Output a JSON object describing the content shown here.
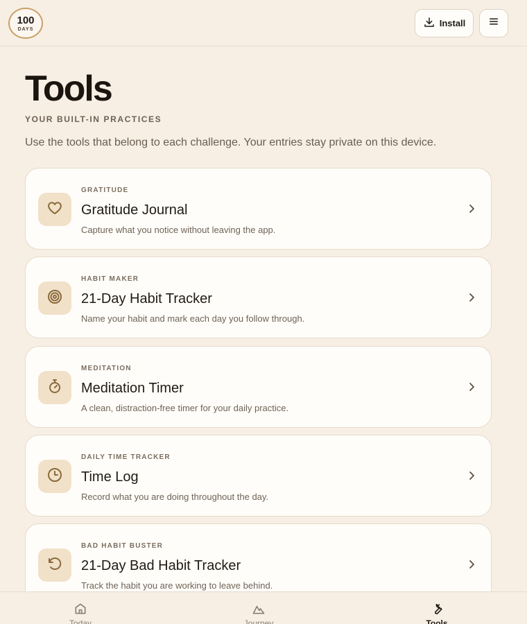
{
  "header": {
    "logo_number": "100",
    "logo_sub": "DAYS",
    "install_label": "Install"
  },
  "page": {
    "title": "Tools",
    "eyebrow": "YOUR BUILT-IN PRACTICES",
    "description": "Use the tools that belong to each challenge. Your entries stay private on this device."
  },
  "tools": [
    {
      "eyebrow": "GRATITUDE",
      "title": "Gratitude Journal",
      "description": "Capture what you notice without leaving the app.",
      "icon": "heart-icon"
    },
    {
      "eyebrow": "HABIT MAKER",
      "title": "21-Day Habit Tracker",
      "description": "Name your habit and mark each day you follow through.",
      "icon": "target-icon"
    },
    {
      "eyebrow": "MEDITATION",
      "title": "Meditation Timer",
      "description": "A clean, distraction-free timer for your daily practice.",
      "icon": "stopwatch-icon"
    },
    {
      "eyebrow": "DAILY TIME TRACKER",
      "title": "Time Log",
      "description": "Record what you are doing throughout the day.",
      "icon": "clock-icon"
    },
    {
      "eyebrow": "BAD HABIT BUSTER",
      "title": "21-Day Bad Habit Tracker",
      "description": "Track the habit you are working to leave behind.",
      "icon": "rotate-ccw-icon"
    }
  ],
  "nav": {
    "items": [
      {
        "label": "Today",
        "icon": "home-icon"
      },
      {
        "label": "Journey",
        "icon": "mountain-icon"
      },
      {
        "label": "Tools",
        "icon": "wrench-icon"
      }
    ],
    "active": "Tools"
  },
  "colors": {
    "background": "#f7efe4",
    "card": "#fffdf9",
    "icon_tile": "#f1e1c9",
    "icon_stroke": "#8a6a3c",
    "accent_ring": "#c9a06a"
  }
}
